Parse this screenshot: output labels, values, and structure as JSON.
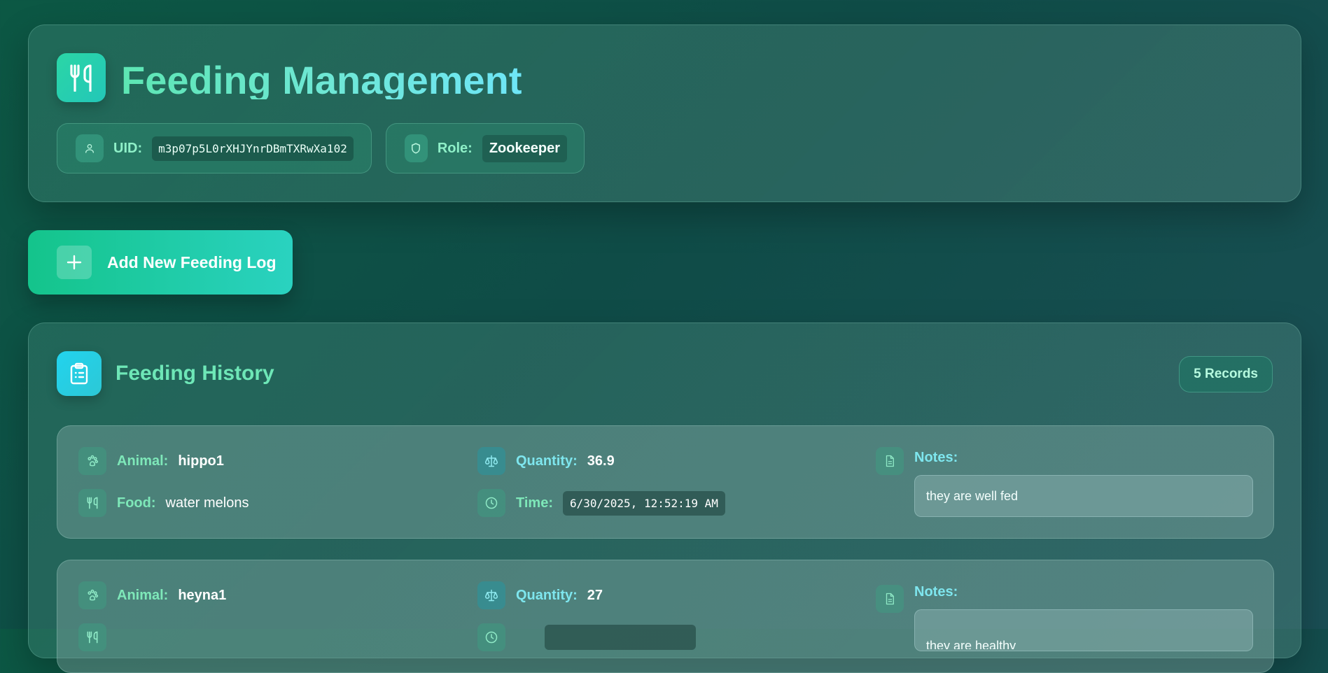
{
  "header": {
    "title": "Feeding Management",
    "uid_label": "UID:",
    "uid_value": "m3p07p5L0rXHJYnrDBmTXRwXa102",
    "role_label": "Role:",
    "role_value": "Zookeeper",
    "icons": [
      "fork-knife-icon",
      "user-icon",
      "shield-icon"
    ]
  },
  "actions": {
    "add_label": "Add New Feeding Log",
    "add_icon": "plus-icon"
  },
  "history": {
    "title": "Feeding History",
    "records_badge": "5 Records",
    "icon": "clipboard-list-icon",
    "labels": {
      "animal": "Animal:",
      "food": "Food:",
      "quantity": "Quantity:",
      "time": "Time:",
      "notes": "Notes:"
    },
    "entries": [
      {
        "animal": "hippo1",
        "food": "water melons",
        "quantity": "36.9",
        "time": "6/30/2025, 12:52:19 AM",
        "notes": "they are well fed"
      },
      {
        "animal": "heyna1",
        "food": "",
        "quantity": "27",
        "time": "",
        "notes": "they are healthy"
      }
    ]
  },
  "colors": {
    "accent_green": "#14c48b",
    "accent_teal": "#2ad2c0",
    "accent_cyan": "#22d3ee",
    "label_green": "#7ee8b9",
    "label_cyan": "#7ee6ee"
  }
}
